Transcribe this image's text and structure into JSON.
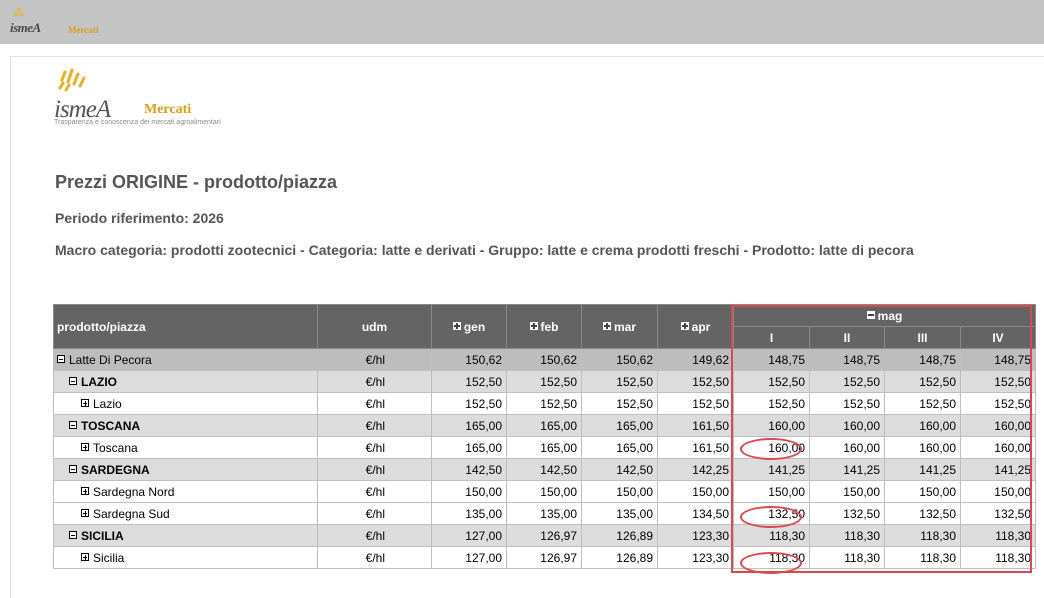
{
  "header": {
    "mini_brand": "ismeA",
    "mini_brand2": "Mercati"
  },
  "logo": {
    "brand": "ismeA",
    "brand2": "Mercati",
    "tagline": "Trasparenza e conoscenza dei mercati agroalimentari"
  },
  "report": {
    "title": "Prezzi ORIGINE - prodotto/piazza",
    "period": "Periodo riferimento: 2026",
    "macro": "Macro categoria: prodotti zootecnici - Categoria: latte e derivati - Gruppo: latte e crema prodotti freschi - Prodotto: latte di pecora"
  },
  "table": {
    "columns": {
      "product": "prodotto/piazza",
      "udm": "udm",
      "months": [
        "gen",
        "feb",
        "mar",
        "apr"
      ],
      "expanded_month": "mag",
      "weeks": [
        "I",
        "II",
        "III",
        "IV"
      ]
    },
    "rows": [
      {
        "name": "Latte Di Pecora",
        "level": 0,
        "udm": "€/hl",
        "values": [
          "150,62",
          "150,62",
          "150,62",
          "149,62",
          "148,75",
          "148,75",
          "148,75",
          "148,75"
        ]
      },
      {
        "name": "LAZIO",
        "level": 1,
        "udm": "€/hl",
        "values": [
          "152,50",
          "152,50",
          "152,50",
          "152,50",
          "152,50",
          "152,50",
          "152,50",
          "152,50"
        ]
      },
      {
        "name": "Lazio",
        "level": 2,
        "udm": "€/hl",
        "values": [
          "152,50",
          "152,50",
          "152,50",
          "152,50",
          "152,50",
          "152,50",
          "152,50",
          "152,50"
        ]
      },
      {
        "name": "TOSCANA",
        "level": 1,
        "udm": "€/hl",
        "values": [
          "165,00",
          "165,00",
          "165,00",
          "161,50",
          "160,00",
          "160,00",
          "160,00",
          "160,00"
        ]
      },
      {
        "name": "Toscana",
        "level": 2,
        "udm": "€/hl",
        "values": [
          "165,00",
          "165,00",
          "165,00",
          "161,50",
          "160,00",
          "160,00",
          "160,00",
          "160,00"
        ]
      },
      {
        "name": "SARDEGNA",
        "level": 1,
        "udm": "€/hl",
        "values": [
          "142,50",
          "142,50",
          "142,50",
          "142,25",
          "141,25",
          "141,25",
          "141,25",
          "141,25"
        ]
      },
      {
        "name": "Sardegna Nord",
        "level": 2,
        "udm": "€/hl",
        "values": [
          "150,00",
          "150,00",
          "150,00",
          "150,00",
          "150,00",
          "150,00",
          "150,00",
          "150,00"
        ]
      },
      {
        "name": "Sardegna Sud",
        "level": 2,
        "udm": "€/hl",
        "values": [
          "135,00",
          "135,00",
          "135,00",
          "134,50",
          "132,50",
          "132,50",
          "132,50",
          "132,50"
        ]
      },
      {
        "name": "SICILIA",
        "level": 1,
        "udm": "€/hl",
        "values": [
          "127,00",
          "126,97",
          "126,89",
          "123,30",
          "118,30",
          "118,30",
          "118,30",
          "118,30"
        ]
      },
      {
        "name": "Sicilia",
        "level": 2,
        "udm": "€/hl",
        "values": [
          "127,00",
          "126,97",
          "126,89",
          "123,30",
          "118,30",
          "118,30",
          "118,30",
          "118,30"
        ]
      }
    ]
  },
  "annotations": {
    "color": "#d9494e",
    "circled_rows": [
      4,
      7,
      9
    ],
    "circled_column": 4
  }
}
